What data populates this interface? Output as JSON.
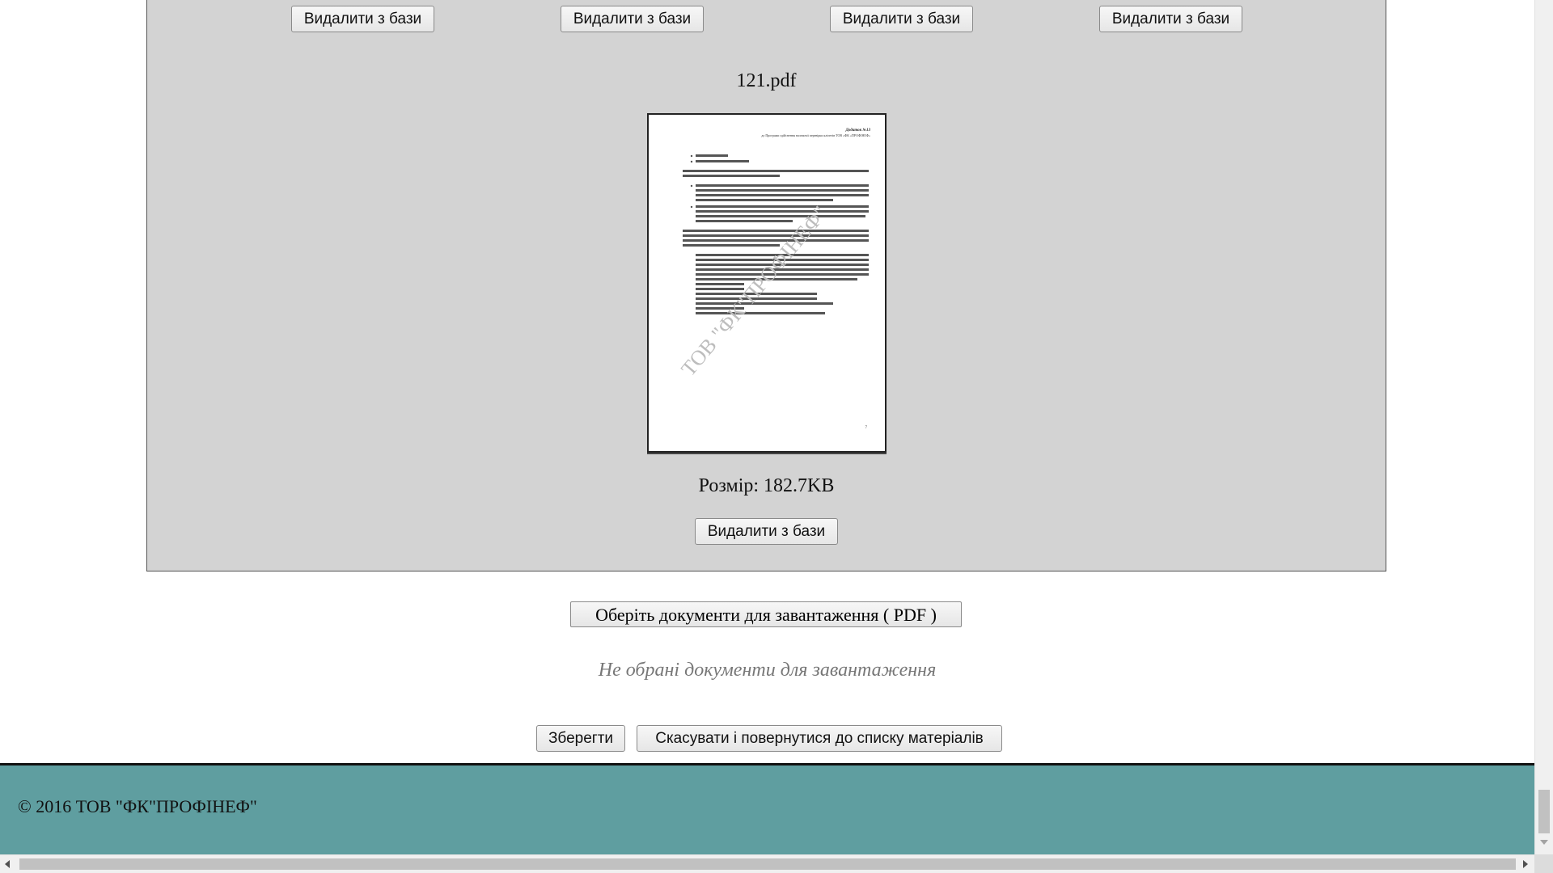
{
  "gallery": {
    "delete_label": "Видалити з бази",
    "file": {
      "name": "121.pdf",
      "size_text": "Розмір: 182.7KB"
    }
  },
  "preview": {
    "header_right_1": "Додаток №13",
    "header_right_2": "до Програми здійснення належної перевірки клієнтів ТОВ «ФК «ПРОФІНЕФ»",
    "watermark": "ТОВ \"ФК\"ПРОФІНЕФ\"",
    "page_number": "7"
  },
  "upload": {
    "choose_label": "Оберіть документи для завантаження ( PDF )",
    "no_docs_text": "Не обрані документи для завантаження"
  },
  "actions": {
    "save_label": "Зберегти",
    "cancel_label": "Скасувати і повернутися до списку матеріалів"
  },
  "footer": {
    "copyright": "© 2016 ТОВ \"ФК\"ПРОФІНЕФ\""
  }
}
